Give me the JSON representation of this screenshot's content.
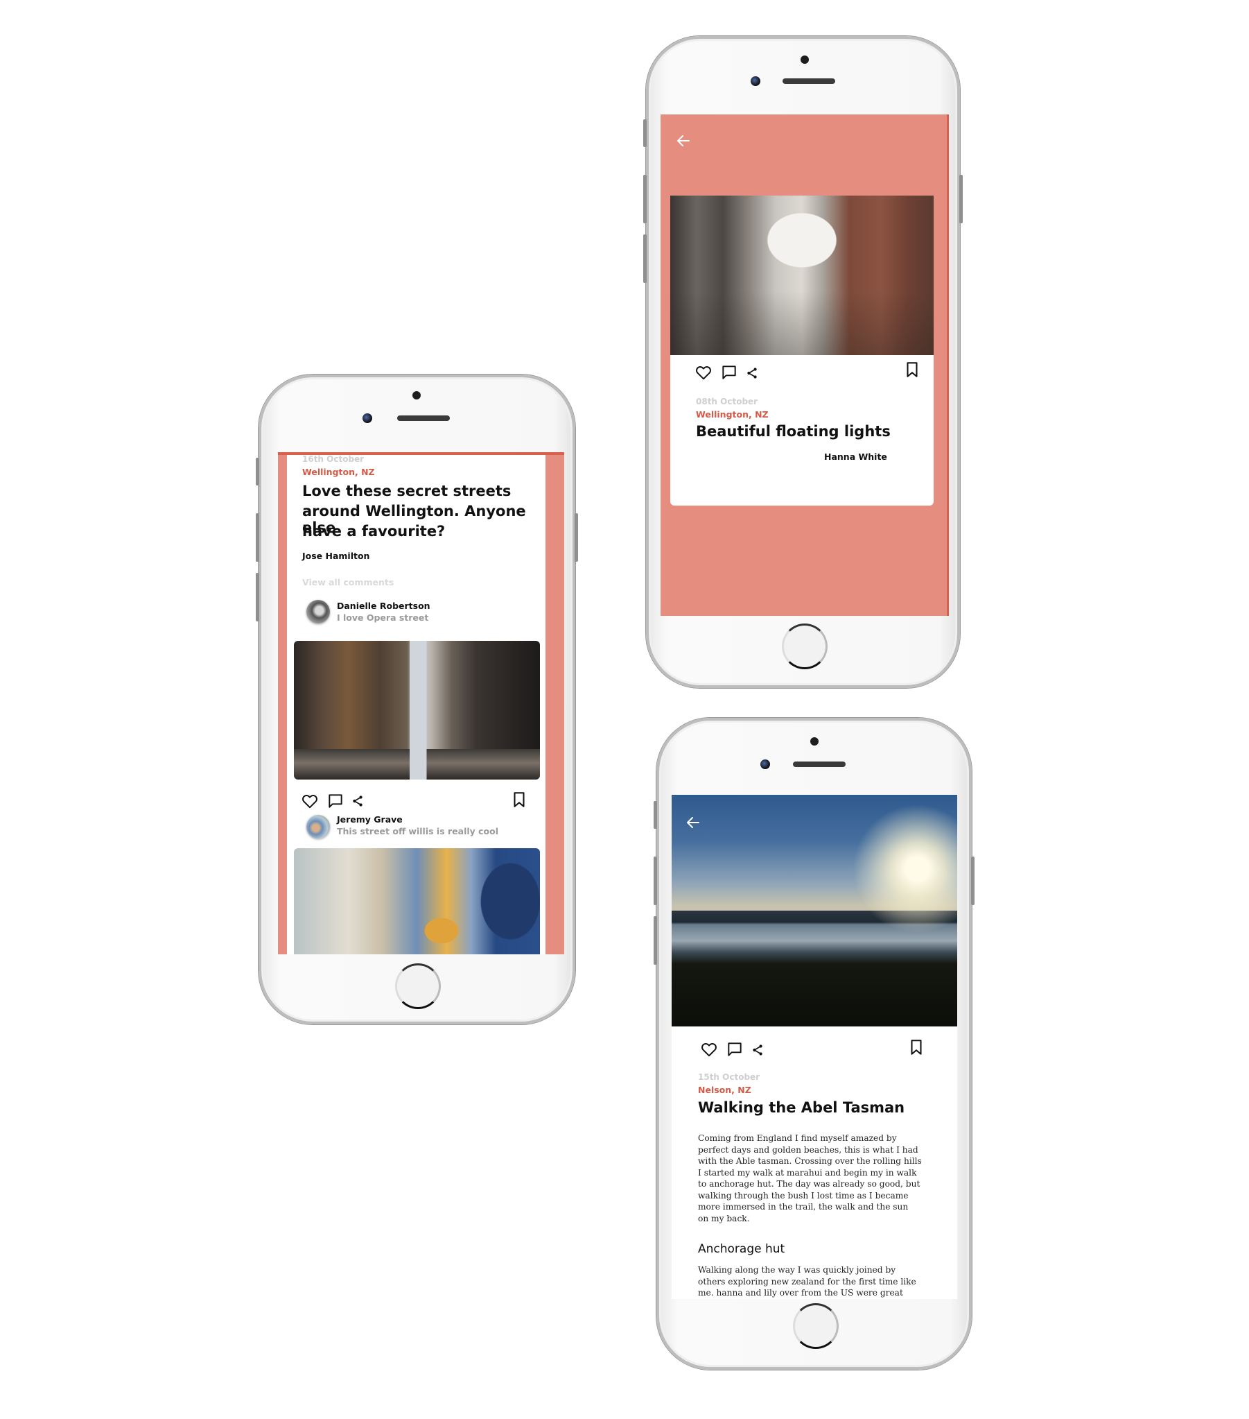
{
  "theme": {
    "accent": "#e58e80",
    "location_color": "#d45a48",
    "date_color": "#cfcfcf"
  },
  "feed_screen": {
    "post": {
      "date": "16th October",
      "location": "Wellington, NZ",
      "title_lines": [
        "Love these secret streets",
        "around Wellington. Anyone else",
        "have a favourite?"
      ],
      "author": "Jose Hamilton"
    },
    "view_all_comments": "View all comments",
    "comments": [
      {
        "name": "Danielle Robertson",
        "text": "I love Opera street",
        "avatar": "danielle-avatar"
      },
      {
        "name": "Jeremy Grave",
        "text": "This street off willis is really cool",
        "avatar": "jeremy-avatar"
      }
    ],
    "images": [
      "alley-photo",
      "mural-photo"
    ],
    "actions": {
      "like": "heart-icon",
      "comment": "comment-icon",
      "share": "share-icon",
      "save": "bookmark-icon"
    }
  },
  "detail_screen": {
    "back": "back-arrow-icon",
    "date": "08th October",
    "location": "Wellington, NZ",
    "title": "Beautiful floating lights",
    "author": "Hanna White",
    "image": "floating-lights-photo"
  },
  "article_screen": {
    "back": "back-arrow-icon",
    "image": "abel-tasman-photo",
    "date": "15th October",
    "location": "Nelson, NZ",
    "title": "Walking the Abel Tasman",
    "paragraph1_lines": [
      "Coming from England I find myself amazed by",
      "perfect days and golden beaches, this is what I had",
      "with the Able tasman. Crossing over the rolling hills",
      "I started my walk at marahui and begin my in walk",
      "to anchorage hut. The day was already so good, but",
      "walking through the bush I lost time as I became",
      "more immersed in the trail, the walk and the sun",
      "on my back."
    ],
    "subheading": "Anchorage hut",
    "paragraph2_lines": [
      "Walking along the way I was quickly joined by",
      "others exploring new zealand for the first time like",
      "me. hanna and lily over from the US were great"
    ]
  }
}
